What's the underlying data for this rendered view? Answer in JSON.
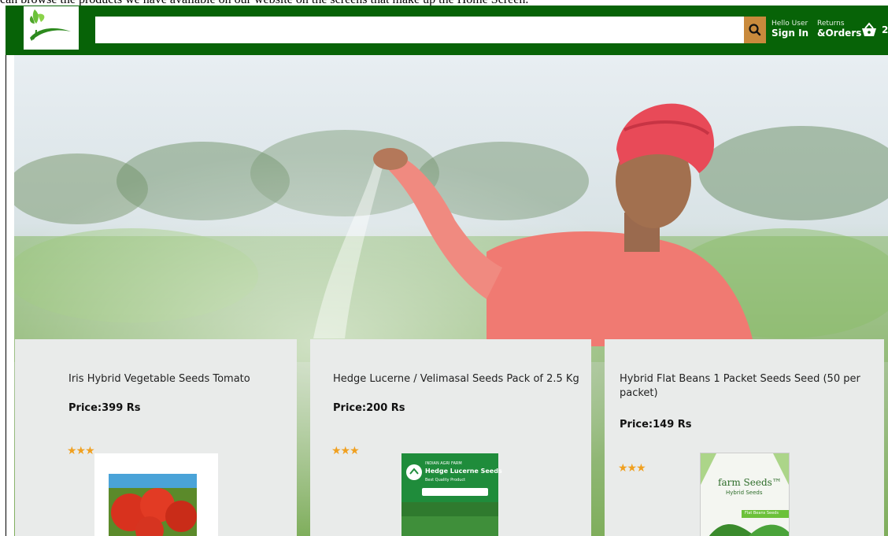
{
  "caption": "can browse the products we have available on our website on the screens that make up the Home Screen.",
  "header": {
    "search": {
      "placeholder": "",
      "value": ""
    },
    "account": {
      "greeting": "Hello User",
      "action": "Sign In"
    },
    "orders": {
      "top": "Returns",
      "bottom": "&Orders"
    },
    "cart": {
      "count": "2"
    }
  },
  "hero": {
    "image": "farmer-sowing-seeds-banner"
  },
  "products": [
    {
      "title": "Iris Hybrid Vegetable Seeds Tomato",
      "price": "Price:399 Rs",
      "stars": "★★★",
      "rating": 2.5,
      "image_label": ""
    },
    {
      "title": "Hedge Lucerne / Velimasal Seeds Pack of 2.5 Kg",
      "price": "Price:200 Rs",
      "stars": "★★★",
      "rating": 3,
      "image_label": "Hedge Lucerne Seeds",
      "image_sublabel": "Best Quality Product",
      "image_brand": "INDIAN AGRI FARM"
    },
    {
      "title": "Hybrid Flat Beans 1 Packet Seeds Seed (50 per packet)",
      "price": "Price:149 Rs",
      "stars": "★★★",
      "rating": 3,
      "image_label": "farm Seeds™",
      "image_sublabel": "Hybrid Seeds",
      "image_tag": "Flat Beans Seeds"
    }
  ],
  "colors": {
    "navbar": "#076307",
    "search_button": "#c98a3c",
    "card": "#e9ebea",
    "star": "#f0a020"
  }
}
